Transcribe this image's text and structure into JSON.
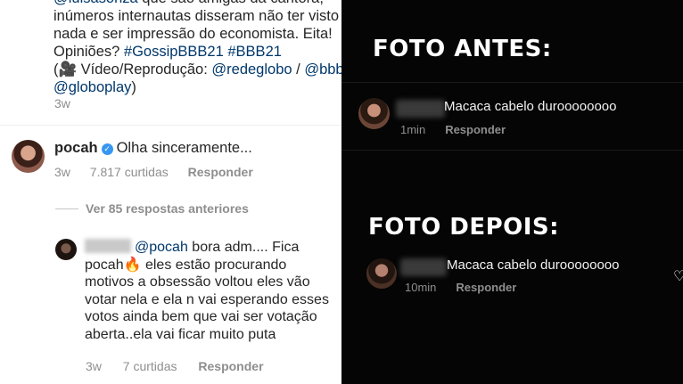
{
  "left": {
    "caption_lines": [
      {
        "parts": [
          {
            "text": "@luisasonza",
            "link": true
          },
          {
            "text": " que são amigas da cantora,",
            "link": false
          }
        ]
      },
      {
        "parts": [
          {
            "text": "inúmeros internautas disseram não ter visto",
            "link": false
          }
        ]
      },
      {
        "parts": [
          {
            "text": "nada e ser impressão do economista. Eita!",
            "link": false
          }
        ]
      },
      {
        "parts": [
          {
            "text": "Opiniões? ",
            "link": false
          },
          {
            "text": "#GossipBBB21 #BBB21",
            "link": true
          }
        ]
      },
      {
        "parts": [
          {
            "text": "(🎥 Vídeo/Reprodução: ",
            "link": false
          },
          {
            "text": "@redeglobo",
            "link": true
          },
          {
            "text": " / ",
            "link": false
          },
          {
            "text": "@bbb",
            "link": true
          }
        ]
      },
      {
        "parts": [
          {
            "text": "@globoplay",
            "link": true
          },
          {
            "text": ")",
            "link": false
          }
        ]
      }
    ],
    "caption_time": "3w",
    "comment": {
      "username": "pocah",
      "verified_glyph": "✓",
      "text": "Olha sinceramente...",
      "time": "3w",
      "likes": "7.817 curtidas",
      "reply_label": "Responder"
    },
    "view_replies": "Ver 85 respostas anteriores",
    "reply": {
      "mention": "@pocah",
      "text_after_mention": " bora adm.... Fica pocah🔥 eles estão procurando motivos a obsessão voltou eles vão votar nela e ela n vai esperando esses votos ainda bem que vai ser votação aberta..ela vai ficar muito puta",
      "time": "3w",
      "likes": "7 curtidas",
      "reply_label": "Responder"
    }
  },
  "right": {
    "heading_before": "FOTO ANTES:",
    "heading_after": "FOTO DEPOIS:",
    "comment_before": {
      "text": "Macaca cabelo duroooooooo",
      "time": "1min",
      "reply_label": "Responder"
    },
    "comment_after": {
      "text": "Macaca cabelo duroooooooo",
      "time": "10min",
      "reply_label": "Responder"
    },
    "heart_icon": "heart-outline-icon"
  },
  "colors": {
    "link": "#00376b",
    "verified": "#3897f0",
    "muted": "#8e8e8e",
    "dark_bg": "#050505"
  }
}
